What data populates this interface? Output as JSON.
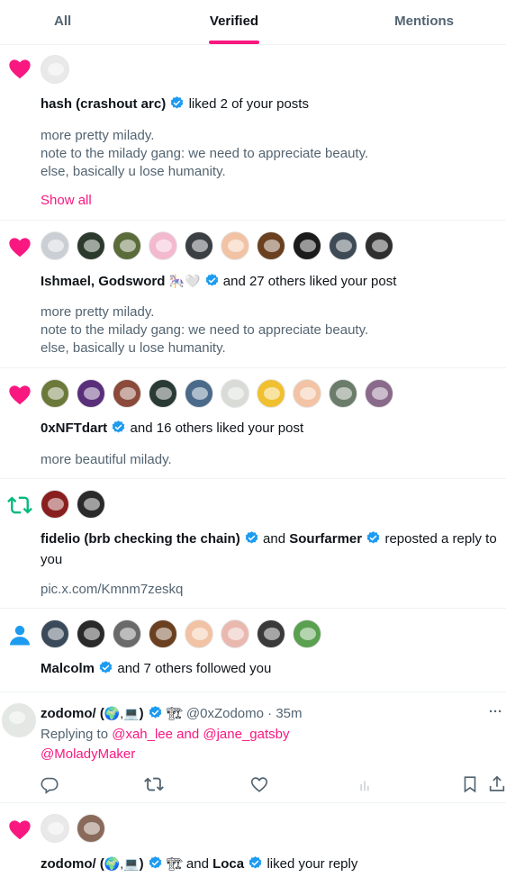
{
  "tabs": [
    {
      "label": "All"
    },
    {
      "label": "Verified"
    },
    {
      "label": "Mentions"
    }
  ],
  "colors": {
    "accent": "#f91880",
    "verified": "#1d9bf0",
    "repost": "#00ba7c",
    "follow": "#1d9bf0",
    "muted": "#536471"
  },
  "notifications": [
    {
      "icon": "heart-icon",
      "avatars": [
        "#e9e9e9"
      ],
      "name": "hash (crashout arc)",
      "action": "liked 2 of your posts",
      "post_lines": [
        "more pretty milady.",
        "note to the milady gang: we need to appreciate beauty.",
        "else, basically u lose humanity."
      ],
      "show_all": "Show all"
    },
    {
      "icon": "heart-icon",
      "avatars": [
        "#c9cfd4",
        "#2b3a2c",
        "#5b6b3a",
        "#f3b9cf",
        "#3a3f44",
        "#f1c3a4",
        "#6a4020",
        "#1b1b1b",
        "#3e4a55",
        "#2f2f2f"
      ],
      "name": "Ishmael, Godsword",
      "name_emoji": "🎠🤍",
      "action": "and 27 others liked your post",
      "post_lines": [
        "more pretty milady.",
        "note to the milady gang: we need to appreciate beauty.",
        "else, basically u lose humanity."
      ]
    },
    {
      "icon": "heart-icon",
      "avatars": [
        "#6b7a3a",
        "#5a2f7a",
        "#8b4a3a",
        "#2a3a34",
        "#4a6a8a",
        "#d9dcd6",
        "#f0c030",
        "#f2c3a4",
        "#6b7c6b",
        "#8a6a8a"
      ],
      "name": "0xNFTdart",
      "action": "and 16 others liked your post",
      "post_lines": [
        "more beautiful milady."
      ]
    },
    {
      "icon": "repost-icon",
      "avatars": [
        "#8a1f1f",
        "#2a2a2a"
      ],
      "name": "fidelio (brb checking the chain)",
      "conj": "and",
      "name2": "Sourfarmer",
      "action": "reposted a reply to",
      "action2": "you",
      "link": "pic.x.com/Kmnm7zeskq"
    },
    {
      "icon": "person-icon",
      "avatars": [
        "#3a4a5a",
        "#2a2a2a",
        "#6a6a6a",
        "#6a4020",
        "#f1c3a4",
        "#e9b9b0",
        "#3a3a3a",
        "#5aa050"
      ],
      "name": "Malcolm",
      "action": "and 7 others followed you"
    }
  ],
  "reply": {
    "name": "zodomo/ (",
    "name_emoji": "🌍,💻",
    "name_close": ")",
    "extra_emoji": "🏗",
    "handle": "@0xZodomo",
    "time": "· 35m",
    "replying_to": "Replying to",
    "mention1": "@xah_lee",
    "and": "and",
    "mention2": "@jane_gatsby",
    "mention3": "@MoladyMaker",
    "more": "···"
  },
  "last": {
    "avatars": [
      "#e9e9e9",
      "#8a6a5a"
    ],
    "name": "zodomo/ (",
    "name_emoji": "🌍,💻",
    "name_close": ")",
    "extra_emoji": "🏗",
    "conj": "and",
    "name2": "Loca",
    "action": "liked your reply"
  }
}
